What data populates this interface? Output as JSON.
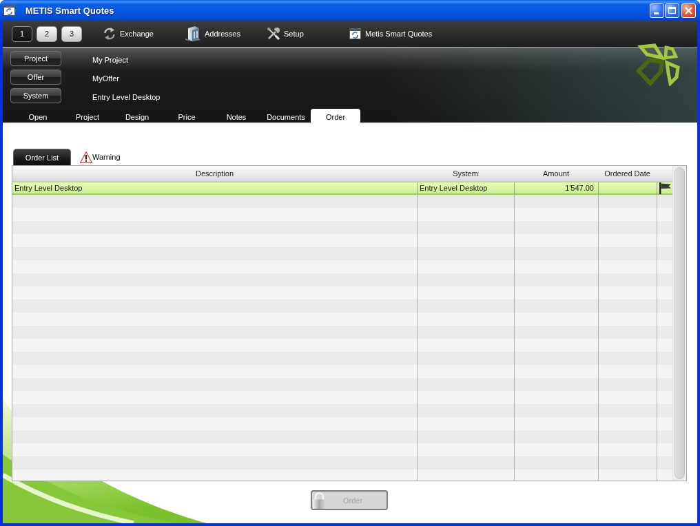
{
  "window": {
    "title": "METIS Smart Quotes"
  },
  "toolbar": {
    "pages": [
      {
        "label": "1",
        "selected": true
      },
      {
        "label": "2",
        "selected": false
      },
      {
        "label": "3",
        "selected": false
      }
    ],
    "items": [
      {
        "kind": "exchange",
        "label": "Exchange"
      },
      {
        "kind": "addresses",
        "label": "Addresses"
      },
      {
        "kind": "setup",
        "label": "Setup"
      },
      {
        "kind": "app",
        "label": "Metis Smart Quotes"
      }
    ]
  },
  "context_rows": [
    {
      "button": "Project",
      "value": "My Project"
    },
    {
      "button": "Offer",
      "value": "MyOffer"
    },
    {
      "button": "System",
      "value": "Entry Level Desktop"
    }
  ],
  "nav_tabs": [
    {
      "label": "Open",
      "selected": false
    },
    {
      "label": "Project",
      "selected": false
    },
    {
      "label": "Design",
      "selected": false
    },
    {
      "label": "Price",
      "selected": false
    },
    {
      "label": "Notes",
      "selected": false
    },
    {
      "label": "Documents",
      "selected": false
    },
    {
      "label": "Order",
      "selected": true
    }
  ],
  "sub_tabs": [
    {
      "kind": "plain",
      "label": "Order List",
      "selected": true
    },
    {
      "kind": "warning",
      "label": "Warning",
      "selected": false
    }
  ],
  "table": {
    "columns": [
      "Description",
      "System",
      "Amount",
      "Ordered Date"
    ],
    "rows": [
      {
        "description": "Entry Level Desktop",
        "system": "Entry Level Desktop",
        "amount": "1'547.00",
        "flagged": true,
        "selected": true
      }
    ]
  },
  "order_button": {
    "label": "Order",
    "disabled": true
  }
}
